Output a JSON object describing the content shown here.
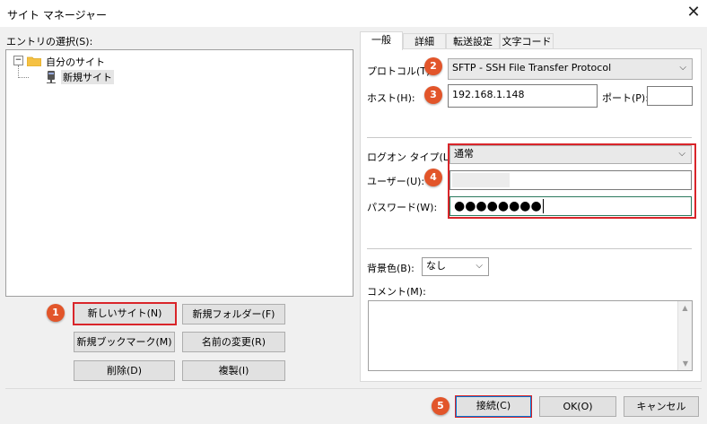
{
  "window": {
    "title": "サイト マネージャー"
  },
  "left": {
    "entry_label": "エントリの選択(S):",
    "tree": {
      "expander": "⊟",
      "folder_label": "自分のサイト",
      "site_label": "新規サイト"
    },
    "buttons": {
      "new_site": "新しいサイト(N)",
      "new_folder": "新規フォルダー(F)",
      "new_bookmark": "新規ブックマーク(M)",
      "rename": "名前の変更(R)",
      "delete": "削除(D)",
      "duplicate": "複製(I)"
    }
  },
  "tabs": [
    "一般",
    "詳細",
    "転送設定",
    "文字コード"
  ],
  "general": {
    "protocol_label": "プロトコル(T):",
    "protocol_value": "SFTP - SSH File Transfer Protocol",
    "host_label": "ホスト(H):",
    "host_value": "192.168.1.148",
    "port_label": "ポート(P):",
    "port_value": "",
    "logon_type_label": "ログオン タイプ(L):",
    "logon_type_value": "通常",
    "user_label": "ユーザー(U):",
    "user_value": "",
    "password_label": "パスワード(W):",
    "password_value": "●●●●●●●●",
    "bg_color_label": "背景色(B):",
    "bg_color_value": "なし",
    "comment_label": "コメント(M):"
  },
  "footer": {
    "connect": "接続(C)",
    "ok": "OK(O)",
    "cancel": "キャンセル"
  },
  "badges": [
    "1",
    "2",
    "3",
    "4",
    "5"
  ],
  "colors": {
    "highlight": "#d9252a",
    "badge": "#e2552a",
    "folder": "#f5c143",
    "accent": "#0078d7"
  },
  "icons": {
    "folder": "folder-icon",
    "site": "server-icon",
    "close": "close-icon",
    "chevron": "chevron-down-icon"
  }
}
